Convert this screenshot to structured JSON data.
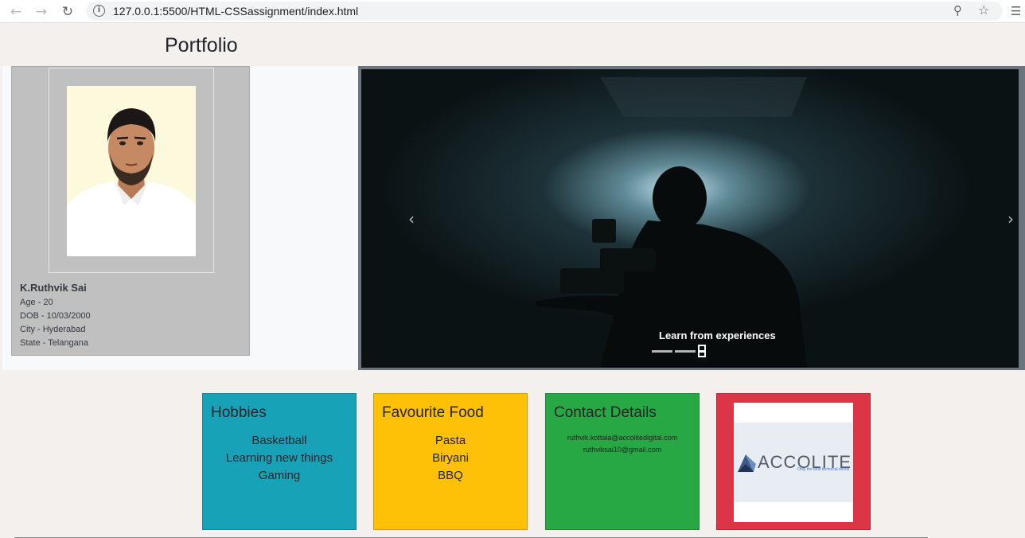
{
  "browser": {
    "url": "127.0.0.1:5500/HTML-CSSassignment/index.html",
    "icons": [
      "back-arrow-icon",
      "forward-arrow-icon",
      "reload-icon",
      "info-icon",
      "zoom-icon",
      "star-icon",
      "extensions-icon"
    ]
  },
  "header": {
    "title": "Portfolio"
  },
  "profile": {
    "name": "K.Ruthvik Sai",
    "age": "Age - 20",
    "dob": "DOB - 10/03/2000",
    "city": "City - Hyderabad",
    "state": "State - Telangana"
  },
  "carousel": {
    "caption": "Learn from experiences",
    "slide_count": 3,
    "active_index": 3
  },
  "cards": {
    "hobbies": {
      "title": "Hobbies",
      "items": [
        "Basketball",
        "Learning new things",
        "Gaming"
      ]
    },
    "food": {
      "title": "Favourite Food",
      "items": [
        "Pasta",
        "Biryani",
        "BBQ"
      ]
    },
    "contact": {
      "title": "Contact Details",
      "items": [
        "ruthvik.kottala@accolitedigital.com",
        "ruthviksai10@gmail.com"
      ]
    },
    "logo": {
      "text": "ACCOLITE",
      "tagline": "Only the best technical minds"
    }
  },
  "colors": {
    "hobbies": "#17a2b8",
    "food": "#ffc107",
    "contact": "#28a745",
    "logo_card": "#dc3545",
    "profile_card": "#c0c0c0"
  }
}
